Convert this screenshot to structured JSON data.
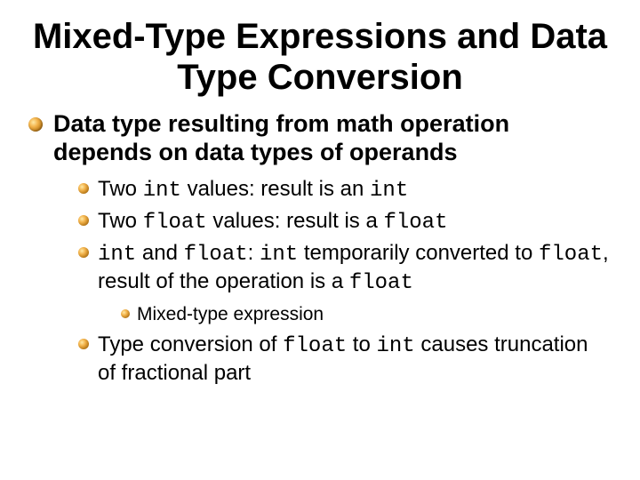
{
  "title": "Mixed-Type Expressions and Data Type Conversion",
  "l1": {
    "text": "Data type resulting from math operation depends on data types of operands"
  },
  "l2a": {
    "pre": "Two ",
    "c1": "int",
    "post": " values: result is an ",
    "c2": "int"
  },
  "l2b": {
    "pre": "Two ",
    "c1": "float",
    "post": " values: result is a ",
    "c2": "float"
  },
  "l2c": {
    "c1": "int",
    "t1": " and ",
    "c2": "float",
    "t2": ": ",
    "c3": "int",
    "t3": " temporarily converted to ",
    "c4": "float",
    "t4": ", result of the operation is a ",
    "c5": "float"
  },
  "l3a": "Mixed-type expression",
  "l2d": {
    "pre": "Type conversion of ",
    "c1": "float",
    "mid": " to ",
    "c2": "int",
    "post": " causes truncation of fractional part"
  }
}
